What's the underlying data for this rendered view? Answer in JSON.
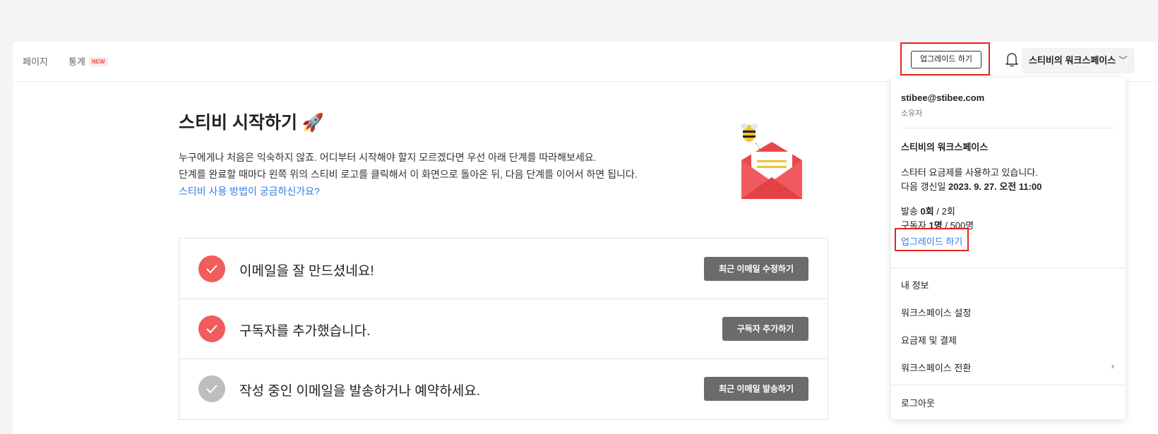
{
  "nav": {
    "pages_label": "페이지",
    "stats_label": "통계",
    "new_badge": "NEW"
  },
  "header": {
    "upgrade_label": "업그레이드 하기",
    "workspace_label": "스티비의 워크스페이스",
    "bell_icon": "bell-icon",
    "chevron_icon": "chevron-down-icon"
  },
  "main": {
    "title": "스티비 시작하기",
    "title_icon": "rocket-icon",
    "intro_line1": "누구에게나 처음은 익숙하지 않죠. 어디부터 시작해야 할지 모르겠다면 우선 아래 단계를 따라해보세요.",
    "intro_line2": "단계를 완료할 때마다 왼쪽 위의 스티비 로고를 클릭해서 이 화면으로 돌아온 뒤, 다음 단계를 이어서 하면 됩니다.",
    "help_link": "스티비 사용 방법이 궁금하신가요?",
    "steps": [
      {
        "text": "이메일을 잘 만드셨네요!",
        "button": "최근 이메일 수정하기",
        "done": true
      },
      {
        "text": "구독자를 추가했습니다.",
        "button": "구독자 추가하기",
        "done": true
      },
      {
        "text": "작성 중인 이메일을 발송하거나 예약하세요.",
        "button": "최근 이메일 발송하기",
        "done": false
      }
    ]
  },
  "dropdown": {
    "email": "stibee@stibee.com",
    "role": "소유자",
    "workspace": "스티비의 워크스페이스",
    "plan_text": "스타터 요금제를 사용하고 있습니다.",
    "renew_prefix": "다음 갱신일",
    "renew_date": "2023. 9. 27. 오전 11:00",
    "send_prefix": "발송",
    "send_used": "0회",
    "send_total": "/ 2회",
    "sub_prefix": "구독자",
    "sub_used": "1명",
    "sub_total": "/ 500명",
    "upgrade_link": "업그레이드 하기",
    "menu": [
      "내 정보",
      "워크스페이스 설정",
      "요금제 및 결제",
      "워크스페이스 전환"
    ],
    "logout": "로그아웃"
  },
  "colors": {
    "check_done": "#f25c5c",
    "check_pending": "#bdbdbd",
    "accent_link": "#2f7de8",
    "step_button": "#6b6b6b"
  }
}
